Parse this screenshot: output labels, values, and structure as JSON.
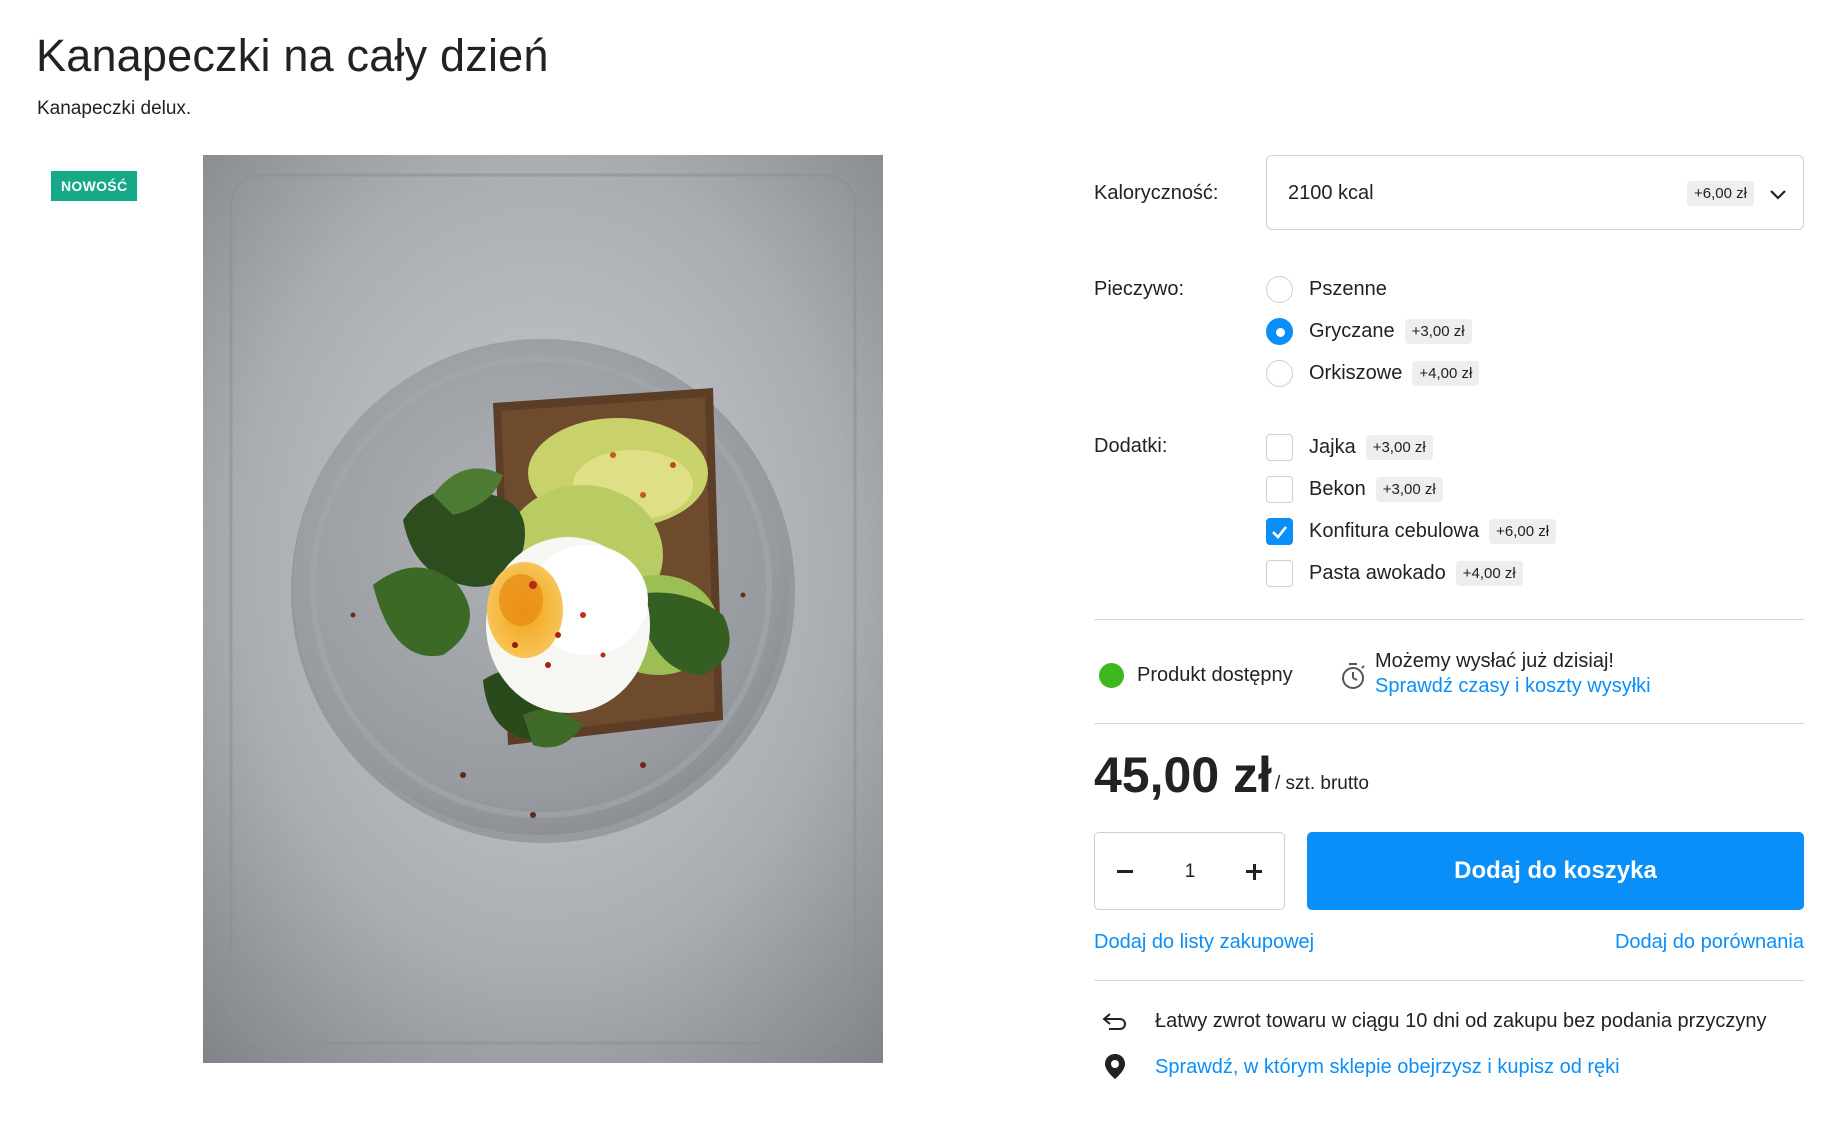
{
  "product": {
    "title": "Kanapeczki na cały dzień",
    "subtitle": "Kanapeczki delux.",
    "badge": "NOWOŚĆ",
    "image_icon": "avocado-toast-photo"
  },
  "options": {
    "calories": {
      "label": "Kaloryczność:",
      "value": "2100 kcal",
      "price": "+6,00 zł"
    },
    "bread": {
      "label": "Pieczywo:",
      "items": [
        {
          "label": "Pszenne",
          "price": "",
          "selected": false
        },
        {
          "label": "Gryczane",
          "price": "+3,00 zł",
          "selected": true
        },
        {
          "label": "Orkiszowe",
          "price": "+4,00 zł",
          "selected": false
        }
      ]
    },
    "extras": {
      "label": "Dodatki:",
      "items": [
        {
          "label": "Jajka",
          "price": "+3,00 zł",
          "checked": false
        },
        {
          "label": "Bekon",
          "price": "+3,00 zł",
          "checked": false
        },
        {
          "label": "Konfitura cebulowa",
          "price": "+6,00 zł",
          "checked": true
        },
        {
          "label": "Pasta awokado",
          "price": "+4,00 zł",
          "checked": false
        }
      ]
    }
  },
  "availability": {
    "status": "Produkt dostępny",
    "status_color": "#3db81f",
    "shipping_text": "Możemy wysłać już dzisiaj!",
    "shipping_link": "Sprawdź czasy i koszty wysyłki"
  },
  "pricing": {
    "price": "45,00 zł",
    "unit": "/ szt. brutto"
  },
  "purchase": {
    "quantity": "1",
    "add_to_cart": "Dodaj do koszyka"
  },
  "links": {
    "shopping_list": "Dodaj do listy zakupowej",
    "compare": "Dodaj do porównania"
  },
  "info": {
    "return_text": "Łatwy zwrot towaru w ciągu 10 dni od zakupu bez podania przyczyny",
    "store_link": "Sprawdź, w którym sklepie obejrzysz i kupisz od ręki"
  },
  "colors": {
    "accent": "#0a8ef8",
    "badge": "#16a988",
    "text": "#222222"
  }
}
